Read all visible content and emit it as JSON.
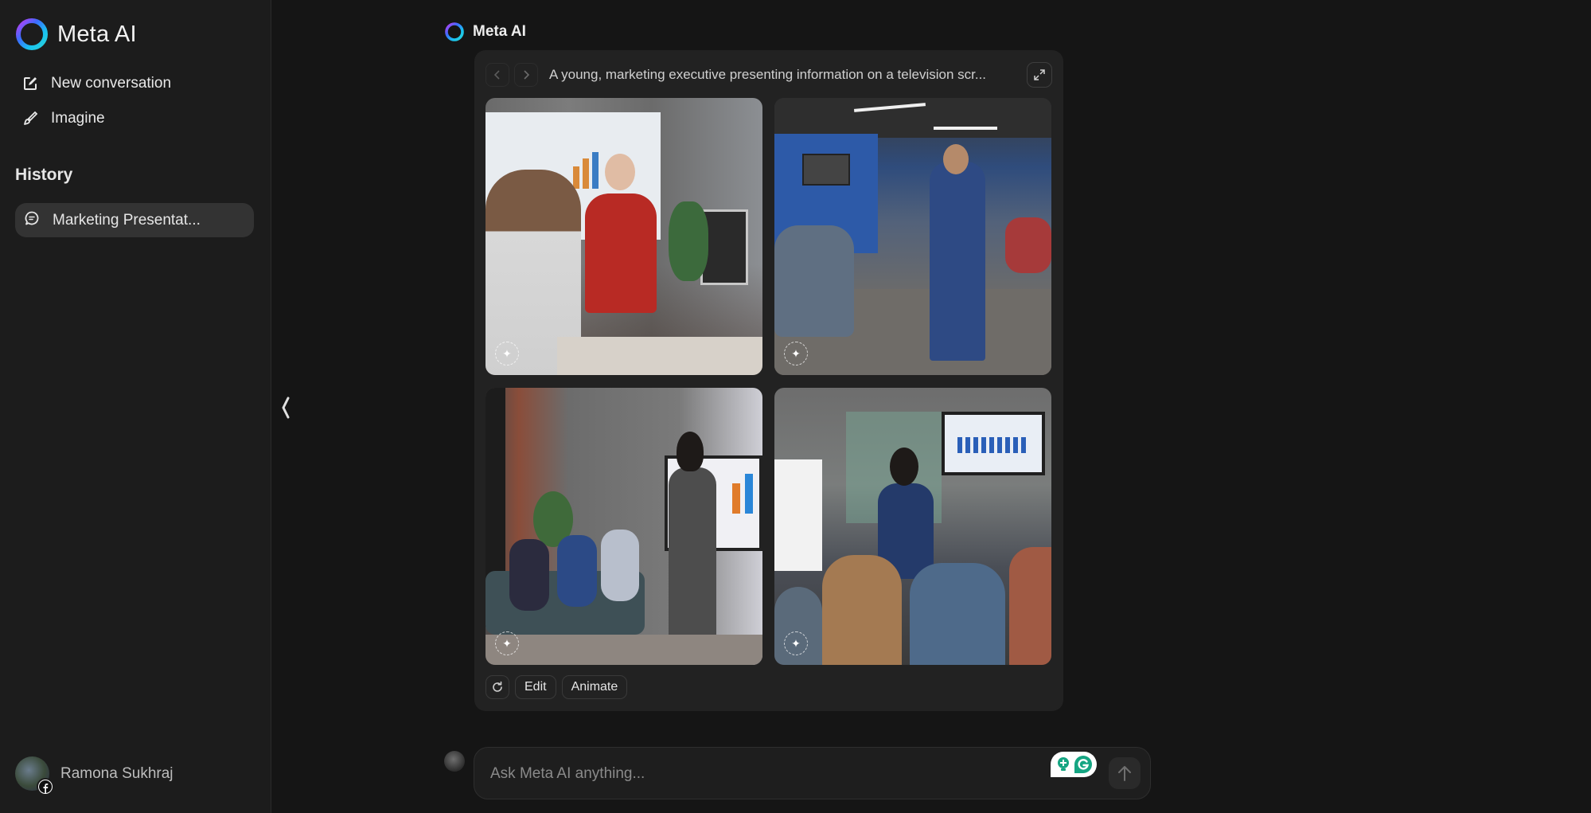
{
  "app": {
    "brand_name": "Meta AI"
  },
  "sidebar": {
    "nav": [
      {
        "label": "New conversation",
        "icon": "new-conversation-icon"
      },
      {
        "label": "Imagine",
        "icon": "brush-icon"
      }
    ],
    "history_title": "History",
    "history_items": [
      {
        "label": "Marketing Presentat...",
        "icon": "chat-bubble-icon",
        "active": true
      }
    ],
    "user": {
      "name": "Ramona Sukhraj",
      "badge": "facebook-icon"
    }
  },
  "conversation": {
    "sender": "Meta AI",
    "image_card": {
      "prompt": "A young, marketing executive presenting information on a television scr...",
      "images": [
        {
          "description": "Woman in red suit presenting charts to colleague at desk"
        },
        {
          "description": "Man in blue suit speaking in open-plan office with coworkers"
        },
        {
          "description": "Woman in grey suit presenting to group seated on couch"
        },
        {
          "description": "Woman in navy suit presenting bar chart on wall TV to team at table"
        }
      ],
      "actions": {
        "regenerate": "regenerate-icon",
        "edit": "Edit",
        "animate": "Animate"
      }
    }
  },
  "composer": {
    "placeholder": "Ask Meta AI anything...",
    "value": ""
  },
  "colors": {
    "background": "#151515",
    "sidebar": "#1c1c1c",
    "card": "#222222",
    "active_item": "#333333",
    "grammarly_green": "#15a582"
  }
}
